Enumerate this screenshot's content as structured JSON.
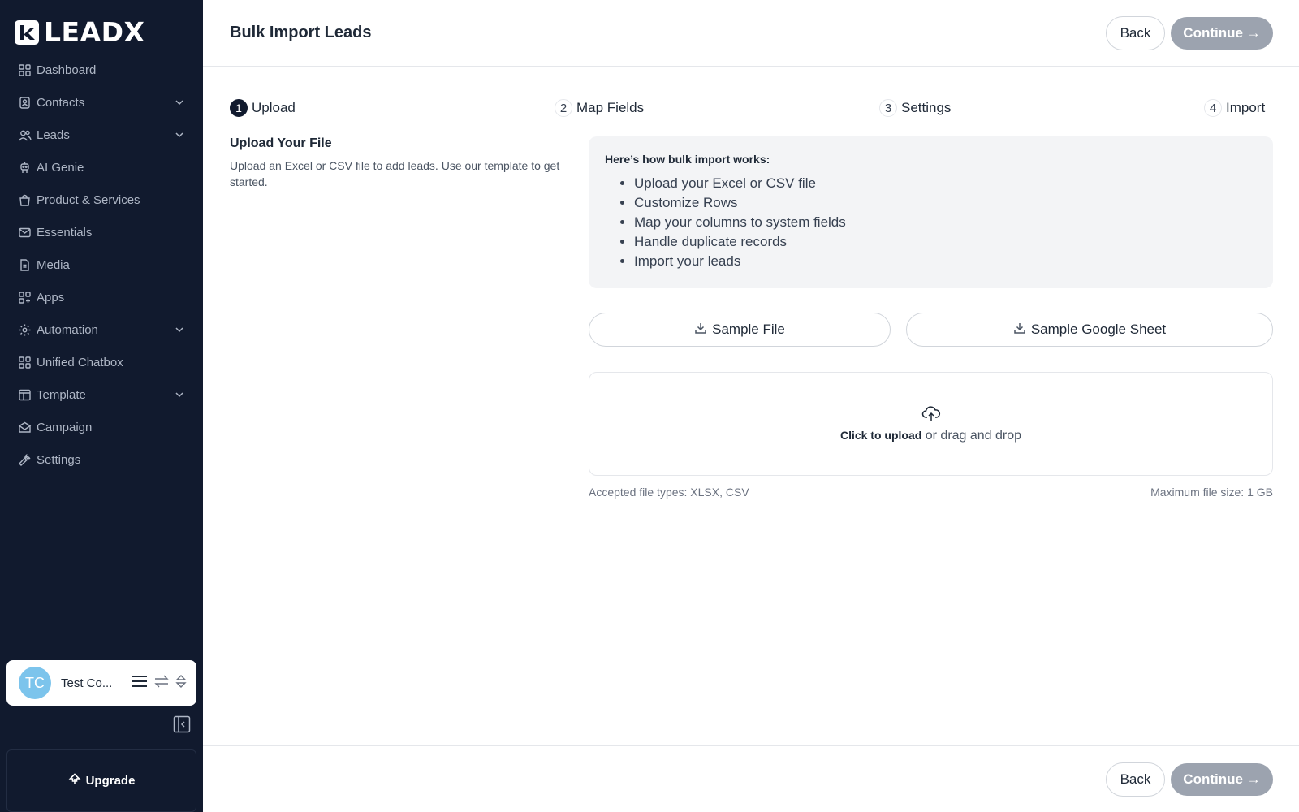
{
  "brand": {
    "name": "LEADX"
  },
  "sidebar": {
    "items": [
      {
        "label": "Dashboard",
        "icon": "grid-icon",
        "expandable": false
      },
      {
        "label": "Contacts",
        "icon": "contact-card-icon",
        "expandable": true
      },
      {
        "label": "Leads",
        "icon": "users-icon",
        "expandable": true
      },
      {
        "label": "AI Genie",
        "icon": "robot-icon",
        "expandable": false
      },
      {
        "label": "Product & Services",
        "icon": "shopping-bag-icon",
        "expandable": false
      },
      {
        "label": "Essentials",
        "icon": "mail-icon",
        "expandable": false
      },
      {
        "label": "Media",
        "icon": "document-icon",
        "expandable": false
      },
      {
        "label": "Apps",
        "icon": "apps-icon",
        "expandable": false
      },
      {
        "label": "Automation",
        "icon": "gear-icon",
        "expandable": true
      },
      {
        "label": "Unified Chatbox",
        "icon": "grid-icon",
        "expandable": false
      },
      {
        "label": "Template",
        "icon": "template-icon",
        "expandable": true
      },
      {
        "label": "Campaign",
        "icon": "envelope-open-icon",
        "expandable": false
      },
      {
        "label": "Settings",
        "icon": "wrench-icon",
        "expandable": false
      }
    ]
  },
  "profile": {
    "initials": "TC",
    "name": "Test Co..."
  },
  "upgrade": {
    "label": "Upgrade"
  },
  "header": {
    "title": "Bulk Import Leads",
    "back_label": "Back",
    "continue_label": "Continue →"
  },
  "stepper": {
    "steps": [
      {
        "num": "1",
        "label": "Upload",
        "active": true
      },
      {
        "num": "2",
        "label": "Map Fields",
        "active": false
      },
      {
        "num": "3",
        "label": "Settings",
        "active": false
      },
      {
        "num": "4",
        "label": "Import",
        "active": false
      }
    ]
  },
  "upload_section": {
    "title": "Upload Your File",
    "description": "Upload an Excel or CSV file to add leads. Use our template to get started."
  },
  "info_box": {
    "title": "Here’s how bulk import works:",
    "items": [
      "Upload your Excel or CSV file",
      "Customize Rows",
      "Map your columns to system fields",
      "Handle duplicate records",
      "Import your leads"
    ]
  },
  "samples": {
    "file_label": "Sample File",
    "sheet_label": "Sample Google Sheet"
  },
  "dropzone": {
    "click_text": "Click to upload",
    "drag_text": " or drag and drop"
  },
  "file_meta": {
    "accepted": "Accepted file types: XLSX, CSV",
    "max_size": "Maximum file size: 1 GB"
  },
  "colors": {
    "sidebar_bg": "#111a2e",
    "continue_disabled": "#9ca3af",
    "avatar": "#7cc4ec"
  }
}
